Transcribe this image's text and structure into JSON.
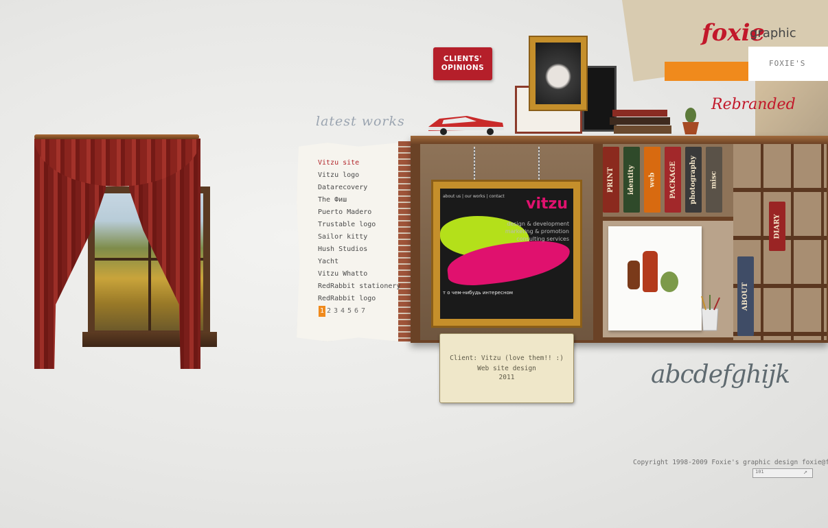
{
  "header": {
    "logo_main": "foxie",
    "logo_sub": "graphic",
    "foxies_label": "FOXIE'S",
    "rebranded": "Rebranded",
    "clients_button": [
      "CLIENTS'",
      "OPINIONS"
    ]
  },
  "latest_works": {
    "title": "latest works",
    "items": [
      {
        "label": "Vitzu site",
        "active": true
      },
      {
        "label": "Vitzu logo"
      },
      {
        "label": "Datarecovery"
      },
      {
        "label": "The Фиш"
      },
      {
        "label": "Puerto Madero"
      },
      {
        "label": "Trustable logo"
      },
      {
        "label": "Sailor kitty"
      },
      {
        "label": "Hush Studios"
      },
      {
        "label": "Yacht"
      },
      {
        "label": "Vitzu Whatto"
      },
      {
        "label": "RedRabbit stationery"
      },
      {
        "label": "RedRabbit logo"
      }
    ],
    "pages": [
      "1",
      "2",
      "3",
      "4",
      "5",
      "6",
      "7"
    ],
    "current_page": "1"
  },
  "featured": {
    "nav": "about us | our works | contact",
    "brand": "vitzu",
    "taglines": [
      "design & development",
      "marketing & promotion",
      "consulting services"
    ],
    "ru_text": "т о чем-нибудь интересном"
  },
  "books": [
    {
      "label": "PRINT",
      "color": "#8b2a1e"
    },
    {
      "label": "identity",
      "color": "#2f4a2a"
    },
    {
      "label": "web",
      "color": "#d86a10"
    },
    {
      "label": "PACKAGE",
      "color": "#a2282a"
    },
    {
      "label": "photography",
      "color": "#3a3a3a"
    },
    {
      "label": "misc",
      "color": "#5a5248"
    }
  ],
  "about_book": "ABOUT",
  "diary_book": "DIARY",
  "caption": {
    "line1": "Client: Vitzu (love them!! :)",
    "line2": "Web site design",
    "line3": "2011"
  },
  "alphabet": "abcdefghijk",
  "footer": {
    "copyright": "Copyright 1998-2009 Foxie's graphic design foxie@foxie.ru",
    "counter": "101"
  }
}
